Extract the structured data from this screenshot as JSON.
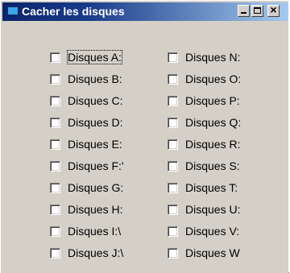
{
  "window": {
    "title": "Cacher les disques"
  },
  "checkboxes": {
    "left": [
      {
        "label": "Disques A:",
        "checked": false,
        "focused": true
      },
      {
        "label": "Disques B:",
        "checked": false
      },
      {
        "label": "Disques C:",
        "checked": false
      },
      {
        "label": "Disques D:",
        "checked": false
      },
      {
        "label": "Disques E:",
        "checked": false
      },
      {
        "label": "Disques F:'",
        "checked": false
      },
      {
        "label": "Disques G:",
        "checked": false
      },
      {
        "label": "Disques H:",
        "checked": false
      },
      {
        "label": "Disques I:\\",
        "checked": false
      },
      {
        "label": "Disques J:\\",
        "checked": false
      }
    ],
    "right": [
      {
        "label": "Disques N:",
        "checked": false
      },
      {
        "label": "Disques O:",
        "checked": false
      },
      {
        "label": "Disques P:",
        "checked": false
      },
      {
        "label": "Disques Q:",
        "checked": false
      },
      {
        "label": "Disques R:",
        "checked": false
      },
      {
        "label": "Disques S:",
        "checked": false
      },
      {
        "label": "Disques T:",
        "checked": false
      },
      {
        "label": "Disques U:",
        "checked": false
      },
      {
        "label": "Disques V:",
        "checked": false
      },
      {
        "label": "Disques W",
        "checked": false
      }
    ]
  }
}
